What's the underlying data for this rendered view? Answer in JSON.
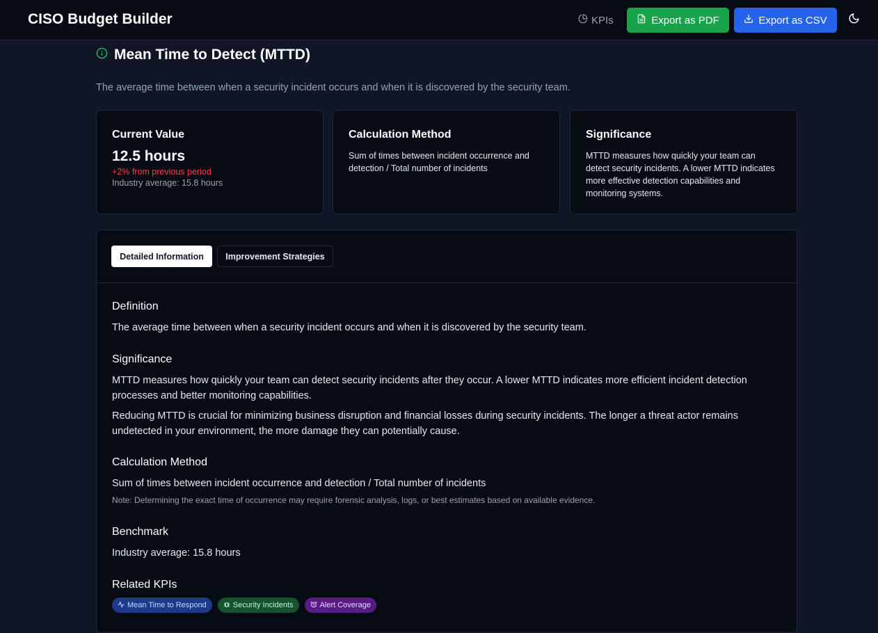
{
  "header": {
    "title": "CISO Budget Builder",
    "kpis_label": "KPIs",
    "export_pdf_label": "Export as PDF",
    "export_csv_label": "Export as CSV"
  },
  "kpi": {
    "title": "Mean Time to Detect (MTTD)",
    "subtitle": "The average time between when a security incident occurs and when it is discovered by the security team."
  },
  "cards": {
    "current": {
      "heading": "Current Value",
      "value": "12.5 hours",
      "change": "+2% from previous period",
      "industry": "Industry average: 15.8 hours"
    },
    "calculation": {
      "heading": "Calculation Method",
      "text": "Sum of times between incident occurrence and detection / Total number of incidents"
    },
    "significance": {
      "heading": "Significance",
      "text": "MTTD measures how quickly your team can detect security incidents. A lower MTTD indicates more effective detection capabilities and monitoring systems."
    }
  },
  "tabs": {
    "detailed": "Detailed Information",
    "improvement": "Improvement Strategies"
  },
  "details": {
    "definition": {
      "heading": "Definition",
      "text": "The average time between when a security incident occurs and when it is discovered by the security team."
    },
    "significance": {
      "heading": "Significance",
      "p1": "MTTD measures how quickly your team can detect security incidents after they occur. A lower MTTD indicates more efficient incident detection processes and better monitoring capabilities.",
      "p2": "Reducing MTTD is crucial for minimizing business disruption and financial losses during security incidents. The longer a threat actor remains undetected in your environment, the more damage they can potentially cause."
    },
    "calculation": {
      "heading": "Calculation Method",
      "text": "Sum of times between incident occurrence and detection / Total number of incidents",
      "note": "Note: Determining the exact time of occurrence may require forensic analysis, logs, or best estimates based on available evidence."
    },
    "benchmark": {
      "heading": "Benchmark",
      "text": "Industry average: 15.8 hours"
    },
    "related": {
      "heading": "Related KPIs",
      "items": [
        "Mean Time to Respond",
        "Security Incidents",
        "Alert Coverage"
      ]
    }
  },
  "colors": {
    "accent_green": "#16a34a",
    "accent_blue": "#2563eb",
    "negative_change": "#ef4444",
    "info_icon": "#22c55e"
  },
  "icons": {
    "kpis": "pie-chart-icon",
    "pdf": "file-text-icon",
    "csv": "download-icon",
    "theme": "moon-icon",
    "title": "info-circle-icon"
  }
}
